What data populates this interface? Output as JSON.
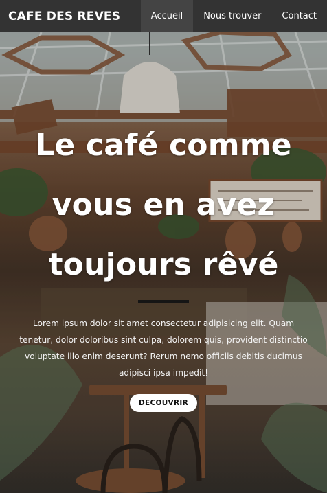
{
  "navbar": {
    "brand": "CAFE DES REVES",
    "links": [
      {
        "label": "Accueil",
        "active": true
      },
      {
        "label": "Nous trouver",
        "active": false
      },
      {
        "label": "Contact",
        "active": false
      }
    ]
  },
  "hero": {
    "headline_lines": [
      "Le café comme",
      "vous en avez",
      "toujours rêvé"
    ],
    "lead": "Lorem ipsum dolor sit amet consectetur adipisicing elit. Quam tenetur, dolor doloribus sint culpa, dolorem quis, provident distinctio voluptate illo enim deserunt? Rerum nemo officiis debitis ducimus adipisci ipsa impedit!",
    "cta_label": "DECOUVRIR"
  }
}
